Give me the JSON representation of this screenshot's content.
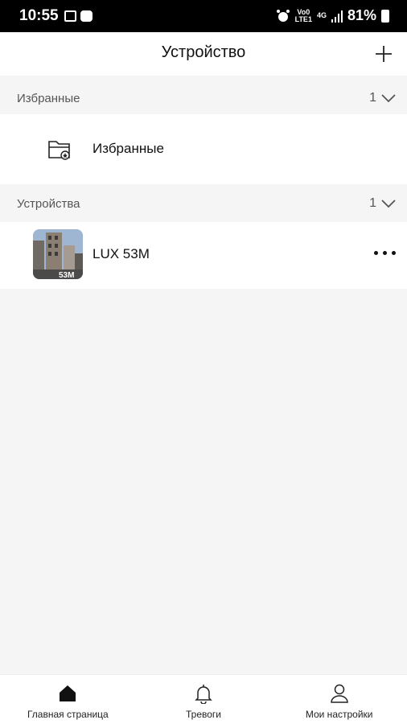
{
  "status_bar": {
    "time": "10:55",
    "volte_top": "Vo0",
    "volte_bottom": "LTE1",
    "network": "4G",
    "battery": "81%"
  },
  "header": {
    "title": "Устройство"
  },
  "favorites_section": {
    "label": "Избранные",
    "count": "1"
  },
  "favorites_item": {
    "label": "Избранные"
  },
  "devices_section": {
    "label": "Устройства",
    "count": "1"
  },
  "device": {
    "name": "LUX 53M",
    "thumb_overlay": "53M"
  },
  "bottom_nav": {
    "home": "Главная страница",
    "alarms": "Тревоги",
    "settings": "Мои настройки"
  }
}
